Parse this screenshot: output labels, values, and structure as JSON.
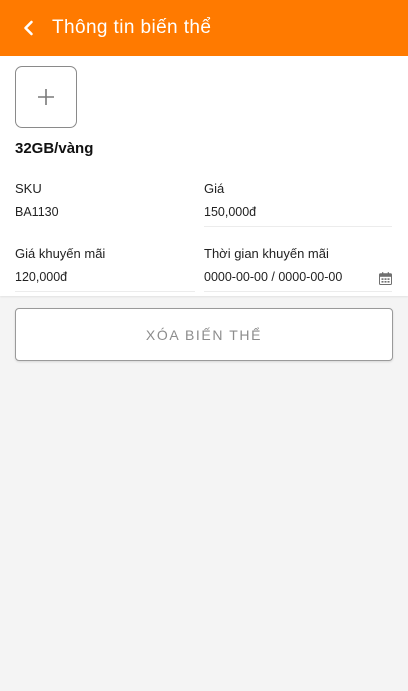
{
  "header": {
    "title": "Thông tin biến thể"
  },
  "icons": {
    "back": "back-chevron-icon",
    "add_image": "plus-icon",
    "date": "calendar-icon"
  },
  "colors": {
    "accent": "#ff7a00"
  },
  "variant": {
    "name": "32GB/vàng"
  },
  "fields": {
    "sku": {
      "label": "SKU",
      "value": "BA1130"
    },
    "price": {
      "label": "Giá",
      "value": "150,000đ"
    },
    "promo_price": {
      "label": "Giá khuyến mãi",
      "value": "120,000đ"
    },
    "promo_time": {
      "label": "Thời gian khuyến mãi",
      "value": "0000-00-00 / 0000-00-00"
    }
  },
  "actions": {
    "delete_label": "XÓA BIẾN THỂ"
  }
}
